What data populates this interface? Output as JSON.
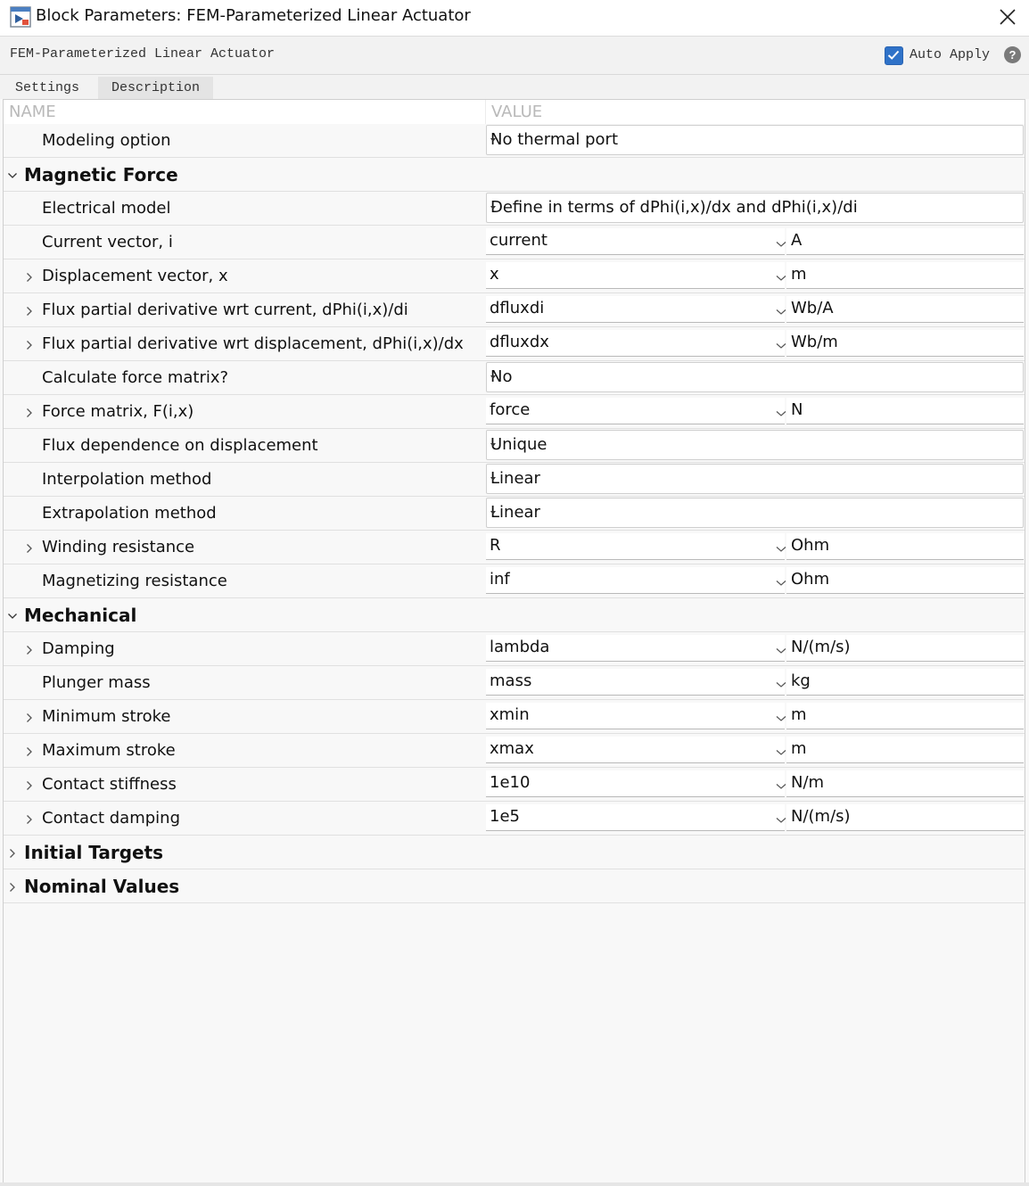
{
  "window": {
    "title": "Block Parameters: FEM-Parameterized Linear Actuator",
    "icon": "simulink-block-icon",
    "close_icon": "close-icon"
  },
  "block": {
    "name": "FEM-Parameterized Linear Actuator",
    "auto_apply_label": "Auto Apply",
    "auto_apply_checked": true,
    "help_label": "?"
  },
  "tabs": [
    {
      "label": "Settings",
      "active": true
    },
    {
      "label": "Description",
      "active": false
    }
  ],
  "grid": {
    "name_header": "NAME",
    "value_header": "VALUE"
  },
  "rows": [
    {
      "kind": "param",
      "label": "Modeling option",
      "expandable": false,
      "control": "dropdown",
      "value": "No thermal port"
    },
    {
      "kind": "section",
      "label": "Magnetic Force",
      "expanded": true
    },
    {
      "kind": "param",
      "label": "Electrical model",
      "expandable": false,
      "control": "dropdown",
      "value": "Define in terms of dPhi(i,x)/dx and dPhi(i,x)/di"
    },
    {
      "kind": "param",
      "label": "Current vector, i",
      "expandable": false,
      "control": "field",
      "value": "current",
      "unit": "A"
    },
    {
      "kind": "param",
      "label": "Displacement vector, x",
      "expandable": true,
      "control": "field",
      "value": "x",
      "unit": "m"
    },
    {
      "kind": "param",
      "label": "Flux partial derivative wrt current, dPhi(i,x)/di",
      "expandable": true,
      "control": "field",
      "value": "dfluxdi",
      "unit": "Wb/A"
    },
    {
      "kind": "param",
      "label": "Flux partial derivative wrt displacement, dPhi(i,x)/dx",
      "expandable": true,
      "control": "field",
      "value": "dfluxdx",
      "unit": "Wb/m"
    },
    {
      "kind": "param",
      "label": "Calculate force matrix?",
      "expandable": false,
      "control": "dropdown",
      "value": "No"
    },
    {
      "kind": "param",
      "label": "Force matrix, F(i,x)",
      "expandable": true,
      "control": "field",
      "value": "force",
      "unit": "N"
    },
    {
      "kind": "param",
      "label": "Flux dependence on displacement",
      "expandable": false,
      "control": "dropdown",
      "value": "Unique"
    },
    {
      "kind": "param",
      "label": "Interpolation method",
      "expandable": false,
      "control": "dropdown",
      "value": "Linear"
    },
    {
      "kind": "param",
      "label": "Extrapolation method",
      "expandable": false,
      "control": "dropdown",
      "value": "Linear"
    },
    {
      "kind": "param",
      "label": "Winding resistance",
      "expandable": true,
      "control": "field",
      "value": "R",
      "unit": "Ohm"
    },
    {
      "kind": "param",
      "label": "Magnetizing resistance",
      "expandable": false,
      "control": "field",
      "value": "inf",
      "unit": "Ohm"
    },
    {
      "kind": "section",
      "label": "Mechanical",
      "expanded": true
    },
    {
      "kind": "param",
      "label": "Damping",
      "expandable": true,
      "control": "field",
      "value": "lambda",
      "unit": "N/(m/s)"
    },
    {
      "kind": "param",
      "label": "Plunger mass",
      "expandable": false,
      "control": "field",
      "value": "mass",
      "unit": "kg"
    },
    {
      "kind": "param",
      "label": "Minimum stroke",
      "expandable": true,
      "control": "field",
      "value": "xmin",
      "unit": "m"
    },
    {
      "kind": "param",
      "label": "Maximum stroke",
      "expandable": true,
      "control": "field",
      "value": "xmax",
      "unit": "m"
    },
    {
      "kind": "param",
      "label": "Contact stiffness",
      "expandable": true,
      "control": "field",
      "value": "1e10",
      "unit": "N/m"
    },
    {
      "kind": "param",
      "label": "Contact damping",
      "expandable": true,
      "control": "field",
      "value": "1e5",
      "unit": "N/(m/s)"
    },
    {
      "kind": "section",
      "label": "Initial Targets",
      "expanded": false
    },
    {
      "kind": "section",
      "label": "Nominal Values",
      "expanded": false
    }
  ],
  "colors": {
    "checkbox_accent": "#2f72c8",
    "header_text": "#b9b9b9"
  }
}
